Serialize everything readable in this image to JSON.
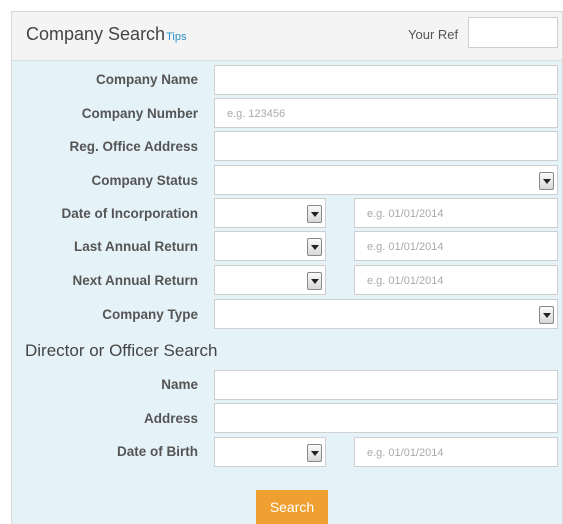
{
  "header": {
    "title": "Company Search",
    "tips_link": "Tips",
    "your_ref_label": "Your Ref"
  },
  "company": {
    "name_label": "Company Name",
    "number_label": "Company Number",
    "number_placeholder": "e.g. 123456",
    "address_label": "Reg. Office Address",
    "status_label": "Company Status",
    "incorp_label": "Date of Incorporation",
    "last_return_label": "Last Annual Return",
    "next_return_label": "Next Annual Return",
    "type_label": "Company Type",
    "date_placeholder": "e.g. 01/01/2014"
  },
  "director": {
    "section_title": "Director or Officer Search",
    "name_label": "Name",
    "address_label": "Address",
    "dob_label": "Date of Birth",
    "date_placeholder": "e.g. 01/01/2014"
  },
  "actions": {
    "search_label": "Search"
  },
  "colors": {
    "panel_bg": "#e5f3f8",
    "accent_button": "#f0a030",
    "link": "#2a8fc7"
  }
}
